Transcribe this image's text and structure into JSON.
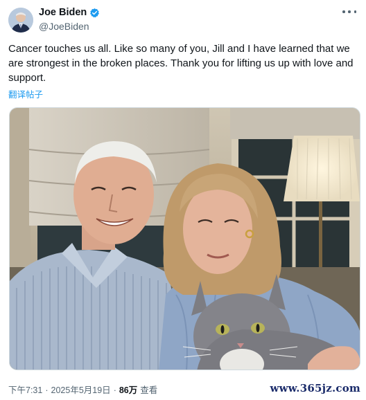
{
  "author": {
    "display_name": "Joe Biden",
    "handle": "@JoeBiden",
    "verified_icon": "verified-badge-icon",
    "badge_color": "#1d9bf0"
  },
  "more_icon": "more-options-icon",
  "tweet": {
    "text": "Cancer touches us all. Like so many of you, Jill and I have learned that we are strongest in the broken places. Thank you for lifting us up with love and support.",
    "translate_label": "翻译帖子"
  },
  "meta": {
    "time": "下午7:31",
    "separator1": "·",
    "date": "2025年5月19日",
    "separator2": "·",
    "views_count": "86万",
    "views_label": "查看"
  },
  "watermark": "www.365jz.com",
  "colors": {
    "accent": "#1d9bf0",
    "text_primary": "#0f1419",
    "text_secondary": "#536471"
  }
}
